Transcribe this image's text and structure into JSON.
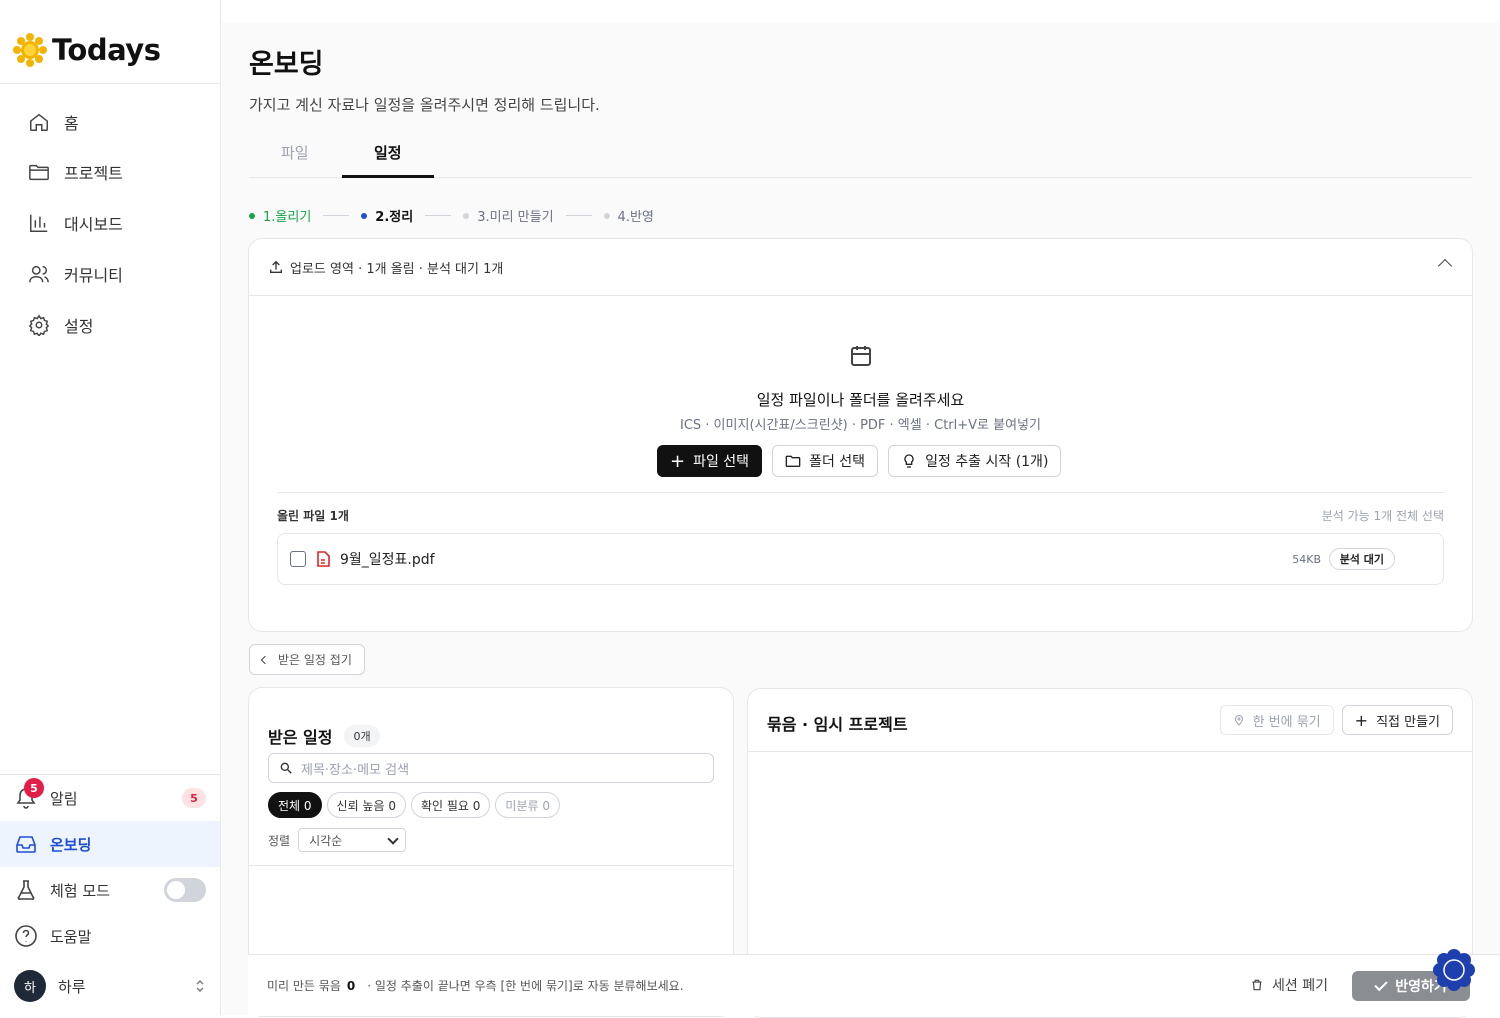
{
  "brand": {
    "name": "Todays"
  },
  "sidebar": {
    "nav": [
      {
        "label": "홈",
        "icon": "home-icon"
      },
      {
        "label": "프로젝트",
        "icon": "folder-icon"
      },
      {
        "label": "대시보드",
        "icon": "chart-icon"
      },
      {
        "label": "커뮤니티",
        "icon": "users-icon"
      },
      {
        "label": "설정",
        "icon": "gear-icon"
      }
    ],
    "alerts": {
      "label": "알림",
      "badge": "5",
      "count": "5"
    },
    "onboarding": {
      "label": "온보딩"
    },
    "trial": {
      "label": "체험 모드",
      "enabled": false
    },
    "help": {
      "label": "도움말"
    },
    "user": {
      "initial": "하",
      "name": "하루"
    }
  },
  "page": {
    "title": "온보딩",
    "subtitle": "가지고 계신 자료나 일정을 올려주시면 정리해 드립니다.",
    "tabs": [
      {
        "label": "파일"
      },
      {
        "label": "일정"
      }
    ],
    "active_tab": "일정",
    "steps": [
      {
        "label": "1.올리기",
        "color": "#16a34a"
      },
      {
        "label": "2.정리",
        "color": "#1d4ed8"
      },
      {
        "label": "3.미리 만들기",
        "color": "#d1d5db"
      },
      {
        "label": "4.반영",
        "color": "#d1d5db"
      }
    ]
  },
  "upload": {
    "header": "업로드 영역 · 1개 올림 · 분석 대기 1개",
    "title": "일정 파일이나 폴더를 올려주세요",
    "subtitle": "ICS · 이미지(시간표/스크린샷) · PDF · 엑셀 · Ctrl+V로 붙여넣기",
    "btn_file": "파일 선택",
    "btn_folder": "폴더 선택",
    "btn_extract": "일정 추출 시작 (1개)",
    "files_label": "올린 파일 1개",
    "select_all": "분석 가능 1개 전체 선택",
    "files": [
      {
        "name": "9월_일정표.pdf",
        "size": "54KB",
        "status": "분석 대기"
      }
    ]
  },
  "fold_button": "받은 일정 접기",
  "received": {
    "title": "받은 일정",
    "count": "0개",
    "search_placeholder": "제목·장소·메모 검색",
    "filters": [
      "전체 0",
      "신뢰 높음 0",
      "확인 필요 0",
      "미분류 0"
    ],
    "sort_label": "정렬",
    "sort_value": "시각순"
  },
  "group": {
    "title": "묶음 · 임시 프로젝트",
    "btn_group": "한 번에 묶기",
    "btn_create": "직접 만들기"
  },
  "bottom": {
    "preview_label": "미리 만든 묶음",
    "preview_count": "0",
    "hint": "· 일정 추출이 끝나면 우측 [한 번에 묶기]로 자동 분류해보세요.",
    "discard": "세션 폐기",
    "apply": "반영하기"
  }
}
